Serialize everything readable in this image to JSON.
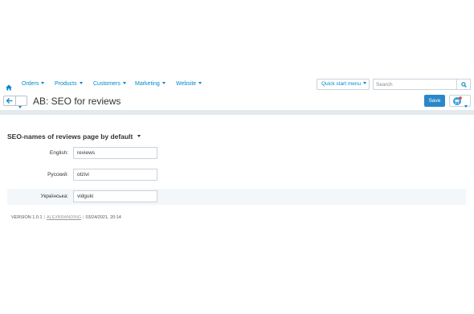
{
  "nav": {
    "items": [
      {
        "label": "Orders"
      },
      {
        "label": "Products"
      },
      {
        "label": "Customers"
      },
      {
        "label": "Marketing"
      },
      {
        "label": "Website"
      }
    ],
    "quick_start_label": "Quick start menu",
    "search_placeholder": "Search"
  },
  "header": {
    "title": "AB: SEO for reviews",
    "save_label": "Save"
  },
  "section": {
    "title": "SEO-names of reviews page by default",
    "fields": [
      {
        "label": "English:",
        "value": "reviews"
      },
      {
        "label": "Русский:",
        "value": "otzivi"
      },
      {
        "label": "Українська:",
        "value": "vidguki"
      }
    ]
  },
  "footer": {
    "version": "VERSION 1.0.1",
    "author": "ALEXBRANDING",
    "datetime": "03/24/2021, 20:14"
  },
  "colors": {
    "accent": "#0088cc",
    "primary_button": "#2b87c8",
    "notification_dot": "#e2413f"
  }
}
